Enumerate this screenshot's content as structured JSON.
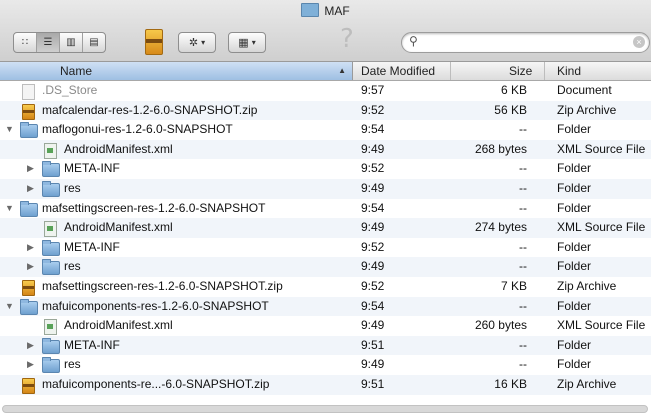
{
  "window": {
    "title": "MAF"
  },
  "toolbar": {
    "view_buttons": [
      "icon-view",
      "list-view",
      "column-view",
      "cover-flow-view"
    ],
    "action_menu_icon": "gear-icon",
    "arrange_menu_icon": "grid-icon",
    "help_glyph": "?",
    "search": {
      "value": "",
      "placeholder": ""
    }
  },
  "columns": {
    "name": "Name",
    "date": "Date Modified",
    "size": "Size",
    "kind": "Kind",
    "sort_indicator": "▲"
  },
  "rows": [
    {
      "name": ".DS_Store",
      "date": "9:57",
      "size": "6 KB",
      "kind": "Document",
      "icon": "document-icon",
      "indent": 0,
      "disclosure": "none",
      "dimmed": true
    },
    {
      "name": "mafcalendar-res-1.2-6.0-SNAPSHOT.zip",
      "date": "9:52",
      "size": "56 KB",
      "kind": "Zip Archive",
      "icon": "zip-archive-icon",
      "indent": 0,
      "disclosure": "none"
    },
    {
      "name": "maflogonui-res-1.2-6.0-SNAPSHOT",
      "date": "9:54",
      "size": "--",
      "kind": "Folder",
      "icon": "folder-icon",
      "indent": 0,
      "disclosure": "open"
    },
    {
      "name": "AndroidManifest.xml",
      "date": "9:49",
      "size": "268 bytes",
      "kind": "XML Source File",
      "icon": "xml-file-icon",
      "indent": 1,
      "disclosure": "none"
    },
    {
      "name": "META-INF",
      "date": "9:52",
      "size": "--",
      "kind": "Folder",
      "icon": "folder-icon",
      "indent": 1,
      "disclosure": "closed"
    },
    {
      "name": "res",
      "date": "9:49",
      "size": "--",
      "kind": "Folder",
      "icon": "folder-icon",
      "indent": 1,
      "disclosure": "closed"
    },
    {
      "name": "mafsettingscreen-res-1.2-6.0-SNAPSHOT",
      "date": "9:54",
      "size": "--",
      "kind": "Folder",
      "icon": "folder-icon",
      "indent": 0,
      "disclosure": "open"
    },
    {
      "name": "AndroidManifest.xml",
      "date": "9:49",
      "size": "274 bytes",
      "kind": "XML Source File",
      "icon": "xml-file-icon",
      "indent": 1,
      "disclosure": "none"
    },
    {
      "name": "META-INF",
      "date": "9:52",
      "size": "--",
      "kind": "Folder",
      "icon": "folder-icon",
      "indent": 1,
      "disclosure": "closed"
    },
    {
      "name": "res",
      "date": "9:49",
      "size": "--",
      "kind": "Folder",
      "icon": "folder-icon",
      "indent": 1,
      "disclosure": "closed"
    },
    {
      "name": "mafsettingscreen-res-1.2-6.0-SNAPSHOT.zip",
      "date": "9:52",
      "size": "7 KB",
      "kind": "Zip Archive",
      "icon": "zip-archive-icon",
      "indent": 0,
      "disclosure": "none"
    },
    {
      "name": "mafuicomponents-res-1.2-6.0-SNAPSHOT",
      "date": "9:54",
      "size": "--",
      "kind": "Folder",
      "icon": "folder-icon",
      "indent": 0,
      "disclosure": "open"
    },
    {
      "name": "AndroidManifest.xml",
      "date": "9:49",
      "size": "260 bytes",
      "kind": "XML Source File",
      "icon": "xml-file-icon",
      "indent": 1,
      "disclosure": "none"
    },
    {
      "name": "META-INF",
      "date": "9:51",
      "size": "--",
      "kind": "Folder",
      "icon": "folder-icon",
      "indent": 1,
      "disclosure": "closed"
    },
    {
      "name": "res",
      "date": "9:49",
      "size": "--",
      "kind": "Folder",
      "icon": "folder-icon",
      "indent": 1,
      "disclosure": "closed"
    },
    {
      "name": "mafuicomponents-re...-6.0-SNAPSHOT.zip",
      "date": "9:51",
      "size": "16 KB",
      "kind": "Zip Archive",
      "icon": "zip-archive-icon",
      "indent": 0,
      "disclosure": "none"
    }
  ],
  "colors": {
    "header_selected": "#9ebfe3",
    "row_stripe": "#f1f5fa",
    "folder": "#6fa0cf",
    "zip": "#d48617"
  }
}
